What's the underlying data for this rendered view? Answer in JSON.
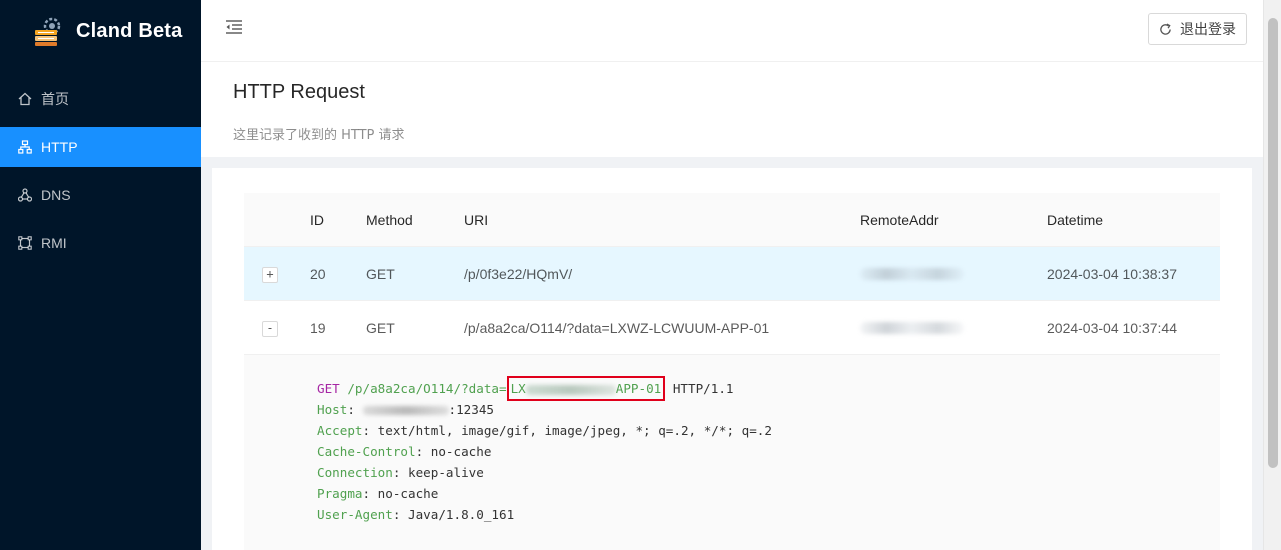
{
  "app": {
    "title": "Cland Beta"
  },
  "sidebar": {
    "items": [
      {
        "label": "首页",
        "icon": "home-icon",
        "active": false
      },
      {
        "label": "HTTP",
        "icon": "sitemap-icon",
        "active": true
      },
      {
        "label": "DNS",
        "icon": "cluster-icon",
        "active": false
      },
      {
        "label": "RMI",
        "icon": "frame-icon",
        "active": false
      }
    ]
  },
  "header": {
    "logout_label": "退出登录"
  },
  "page": {
    "title": "HTTP Request",
    "subtitle": "这里记录了收到的 HTTP 请求"
  },
  "table": {
    "columns": {
      "id": "ID",
      "method": "Method",
      "uri": "URI",
      "remote_addr": "RemoteAddr",
      "datetime": "Datetime"
    },
    "rows": [
      {
        "expand": "+",
        "id": "20",
        "method": "GET",
        "uri": "/p/0f3e22/HQmV/",
        "datetime": "2024-03-04 10:38:37"
      },
      {
        "expand": "-",
        "id": "19",
        "method": "GET",
        "uri": "/p/a8a2ca/O114/?data=LXWZ-LCWUUM-APP-01",
        "datetime": "2024-03-04 10:37:44"
      }
    ]
  },
  "detail": {
    "method": "GET",
    "path_prefix": "/p/a8a2ca/O114/?data=",
    "data_start": "LX",
    "data_end": "APP-01",
    "protocol": "HTTP/1.1",
    "headers": [
      {
        "name": "Host",
        "value": ":12345"
      },
      {
        "name": "Accept",
        "value": "text/html, image/gif, image/jpeg, *; q=.2, */*; q=.2"
      },
      {
        "name": "Cache-Control",
        "value": "no-cache"
      },
      {
        "name": "Connection",
        "value": "keep-alive"
      },
      {
        "name": "Pragma",
        "value": "no-cache"
      },
      {
        "name": "User-Agent",
        "value": "Java/1.8.0_161"
      }
    ]
  },
  "colors": {
    "sidebar_bg": "#001529",
    "accent": "#1890ff",
    "highlight_box": "#e0001b"
  }
}
